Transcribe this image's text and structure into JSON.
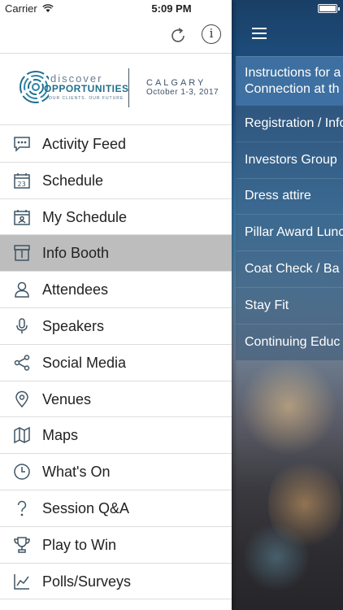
{
  "status_bar": {
    "carrier": "Carrier",
    "time": "5:09 PM"
  },
  "logo": {
    "word_top": "discover",
    "word_main": "OPPORTUNITIES",
    "tagline": "OUR CLIENTS. OUR FUTURE",
    "city": "CALGARY",
    "dates": "October 1-3, 2017"
  },
  "menu": {
    "items": [
      {
        "label": "Activity Feed",
        "icon": "chat-bubble-icon"
      },
      {
        "label": "Schedule",
        "icon": "calendar-icon"
      },
      {
        "label": "My Schedule",
        "icon": "person-calendar-icon"
      },
      {
        "label": "Info Booth",
        "icon": "info-booth-icon"
      },
      {
        "label": "Attendees",
        "icon": "person-icon"
      },
      {
        "label": "Speakers",
        "icon": "microphone-icon"
      },
      {
        "label": "Social Media",
        "icon": "share-icon"
      },
      {
        "label": "Venues",
        "icon": "location-pin-icon"
      },
      {
        "label": "Maps",
        "icon": "map-icon"
      },
      {
        "label": "What's On",
        "icon": "clock-icon"
      },
      {
        "label": "Session Q&A",
        "icon": "question-icon"
      },
      {
        "label": "Play to Win",
        "icon": "trophy-icon"
      },
      {
        "label": "Polls/Surveys",
        "icon": "chart-icon"
      }
    ],
    "selected": "Info Booth"
  },
  "content_list": [
    "Instructions for a Connection at th",
    "Registration / Info",
    "Investors Group",
    "Dress attire",
    "Pillar Award Lunc",
    "Coat Check / Ba",
    "Stay Fit",
    "Continuing Educ"
  ],
  "content_first": {
    "line1": "Instructions for a",
    "line2": "Connection at th"
  }
}
